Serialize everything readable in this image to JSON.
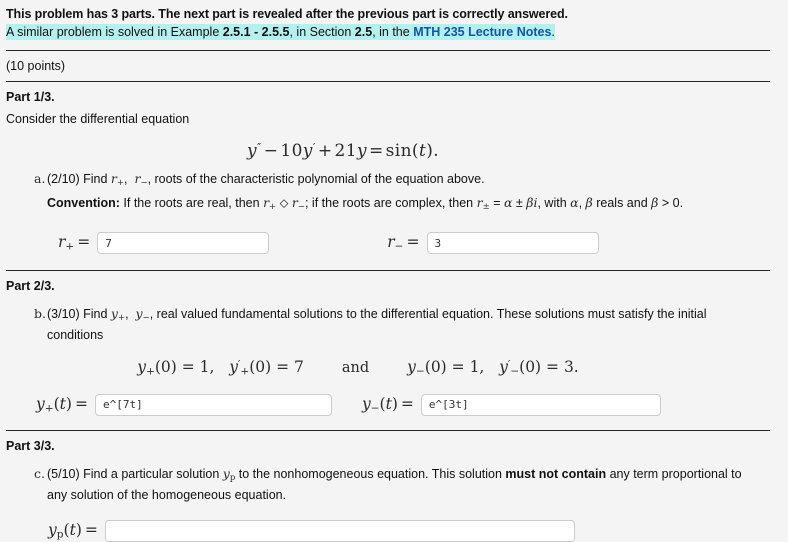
{
  "header": {
    "intro": "This problem has 3 parts. The next part is revealed after the previous part is correctly answered.",
    "similar_prefix": "A similar problem is solved in Example ",
    "example_range": "2.5.1 - 2.5.5",
    "similar_mid": ", in Section ",
    "section": "2.5",
    "similar_mid2": ", in the ",
    "link_text": "MTH 235 Lecture Notes",
    "similar_end": ".",
    "points": "(10 points)",
    "highlight_color": "#b4f0ee",
    "link_color": "#1155aa"
  },
  "part1": {
    "title": "Part 1/3.",
    "intro": "Consider the differential equation",
    "equation": "y'' - 10 y' + 21 y = sin(t).",
    "item": {
      "label": "a.",
      "text": "(2/10) Find r+, r-, roots of the characteristic polynomial of the equation above.",
      "convention_label": "Convention:",
      "convention_text": "If the roots are real, then r+ ⩾ r-; if the roots are complex, then r± = α ± βi, with α, β reals and β > 0."
    },
    "answers": [
      {
        "name": "r-plus",
        "label": "r+ =",
        "value": "7",
        "placeholder": ""
      },
      {
        "name": "r-minus",
        "label": "r- =",
        "value": "3",
        "placeholder": ""
      }
    ]
  },
  "part2": {
    "title": "Part 2/3.",
    "item": {
      "label": "b.",
      "text_line1": "(3/10) Find y+, y-, real valued fundamental solutions to the differential equation. These solutions must satisfy the initial",
      "text_line2": "conditions"
    },
    "initial_conditions": "y+(0) = 1,  y'+(0) = 7   and   y-(0) = 1,  y'-(0) = 3.",
    "and_word": "and",
    "answers": [
      {
        "name": "y-plus",
        "label": "y+(t) =",
        "value": "e^[7t]",
        "placeholder": ""
      },
      {
        "name": "y-minus",
        "label": "y-(t) =",
        "value": "e^[3t]",
        "placeholder": ""
      }
    ]
  },
  "part3": {
    "title": "Part 3/3.",
    "item": {
      "label": "c.",
      "text_line1_a": "(5/10) Find a particular solution ",
      "text_line1_b": " to the nonhomogeneous equation. This solution ",
      "must_not_contain": "must not contain",
      "text_line1_c": " any term proportional to",
      "text_line2": "any solution of the homogeneous equation."
    },
    "answer": {
      "name": "y-particular",
      "label": "yp(t) =",
      "value": "",
      "placeholder": ""
    }
  }
}
